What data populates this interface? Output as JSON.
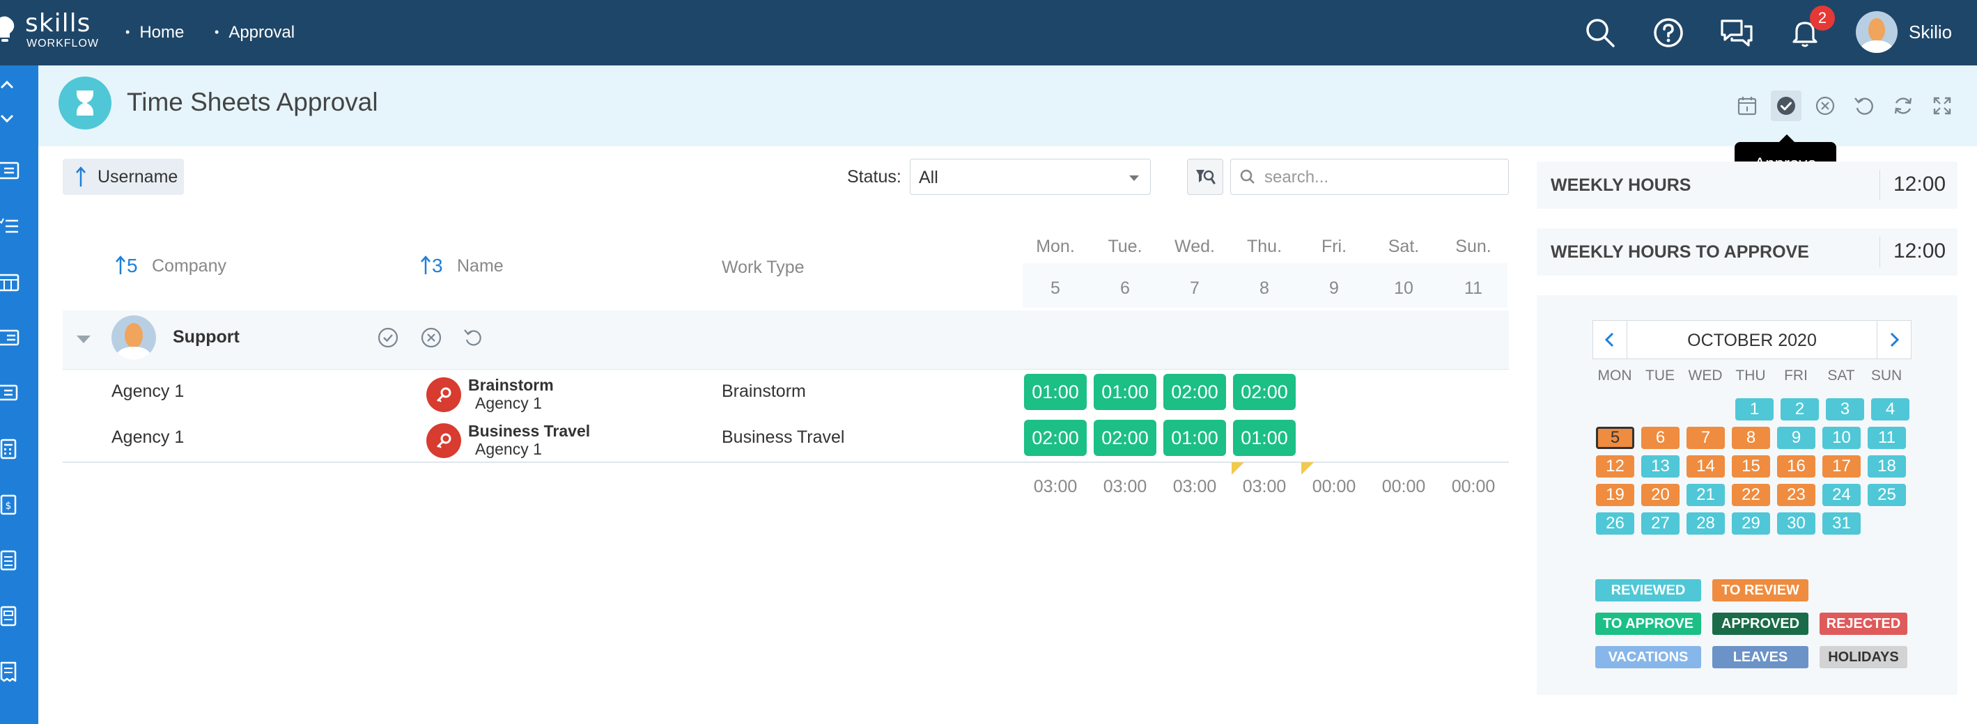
{
  "topbar": {
    "logo_word": "skills",
    "logo_sub": "WORKFLOW",
    "breadcrumbs": [
      "Home",
      "Approval"
    ],
    "notification_count": "2",
    "user_name": "Skilio",
    "icons": [
      "search-icon",
      "help-icon",
      "chat-icon",
      "bell-icon"
    ]
  },
  "header": {
    "title": "Time Sheets Approval",
    "tooltip": "Approve",
    "actions": [
      "calendar-icon",
      "approve-icon",
      "reject-icon",
      "undo-icon",
      "refresh-icon",
      "expand-icon"
    ]
  },
  "toolbar": {
    "sort_label": "Username",
    "status_label": "Status:",
    "status_value": "All",
    "search_placeholder": "search..."
  },
  "table": {
    "columns": {
      "company": "Company",
      "company_sort": "5",
      "name": "Name",
      "name_sort": "3",
      "work_type": "Work Type"
    },
    "days": [
      {
        "name": "Mon.",
        "num": "5"
      },
      {
        "name": "Tue.",
        "num": "6"
      },
      {
        "name": "Wed.",
        "num": "7"
      },
      {
        "name": "Thu.",
        "num": "8"
      },
      {
        "name": "Fri.",
        "num": "9"
      },
      {
        "name": "Sat.",
        "num": "10"
      },
      {
        "name": "Sun.",
        "num": "11"
      }
    ],
    "group": {
      "name": "Support"
    },
    "rows": [
      {
        "company": "Agency 1",
        "task": "Brainstorm",
        "task_sub": "Agency 1",
        "work_type": "Brainstorm",
        "hours": [
          "01:00",
          "01:00",
          "02:00",
          "02:00"
        ]
      },
      {
        "company": "Agency 1",
        "task": "Business Travel",
        "task_sub": "Agency 1",
        "work_type": "Business Travel",
        "hours": [
          "02:00",
          "02:00",
          "01:00",
          "01:00"
        ]
      }
    ],
    "totals": [
      "03:00",
      "03:00",
      "03:00",
      "03:00",
      "00:00",
      "00:00",
      "00:00"
    ]
  },
  "summary": {
    "weekly_hours_label": "WEEKLY HOURS",
    "weekly_hours": "12:00",
    "weekly_to_approve_label": "WEEKLY HOURS TO APPROVE",
    "weekly_to_approve": "12:00"
  },
  "calendar": {
    "month": "OCTOBER 2020",
    "weekdays": [
      "MON",
      "TUE",
      "WED",
      "THU",
      "FRI",
      "SAT",
      "SUN"
    ],
    "weeks": [
      [
        "",
        "",
        "",
        "1",
        "2",
        "3",
        "4"
      ],
      [
        "5",
        "6",
        "7",
        "8",
        "9",
        "10",
        "11"
      ],
      [
        "12",
        "13",
        "14",
        "15",
        "16",
        "17",
        "18"
      ],
      [
        "19",
        "20",
        "21",
        "22",
        "23",
        "24",
        "25"
      ],
      [
        "26",
        "27",
        "28",
        "29",
        "30",
        "31",
        ""
      ]
    ],
    "legend": {
      "reviewed": "REVIEWED",
      "to_review": "TO REVIEW",
      "to_approve": "TO APPROVE",
      "approved": "APPROVED",
      "rejected": "REJECTED",
      "vacations": "VACATIONS",
      "leaves": "LEAVES",
      "holidays": "HOLIDAYS"
    }
  },
  "colors": {
    "topbar": "#1e4668",
    "sidebar": "#1f7fd8",
    "reviewed": "#4fc7d6",
    "to_review": "#ef8c3f",
    "to_approve": "#1cbf85",
    "approved": "#1a6b47",
    "rejected": "#df5a5a",
    "vacations": "#86b6ea",
    "leaves": "#6b93c8",
    "holidays": "#d3d3d3"
  }
}
